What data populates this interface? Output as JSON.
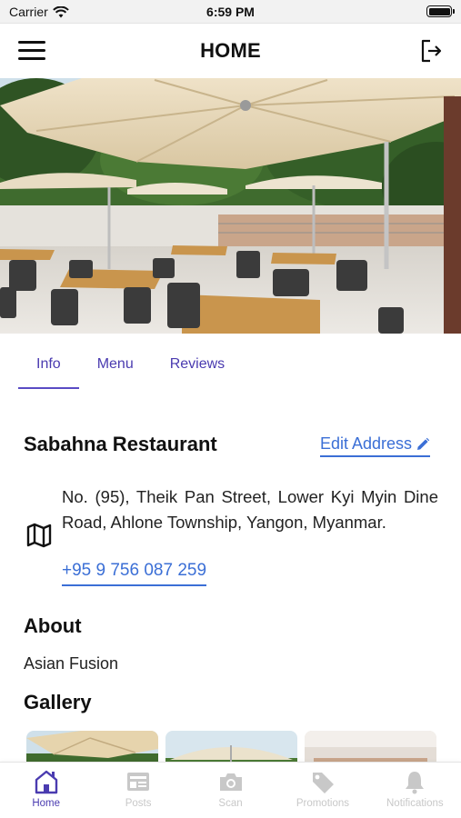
{
  "status_bar": {
    "carrier": "Carrier",
    "time": "6:59 PM"
  },
  "header": {
    "title": "HOME"
  },
  "tabs": [
    {
      "label": "Info",
      "active": true
    },
    {
      "label": "Menu",
      "active": false
    },
    {
      "label": "Reviews",
      "active": false
    }
  ],
  "restaurant": {
    "name": "Sabahna Restaurant",
    "edit_address_label": "Edit Address",
    "address": "No. (95), Theik Pan Street, Lower Kyi Myin Dine Road, Ahlone Township, Yangon, Myanmar.",
    "phone": "+95 9 756 087 259"
  },
  "about": {
    "title": "About",
    "text": "Asian Fusion"
  },
  "gallery": {
    "title": "Gallery"
  },
  "bottom_nav": [
    {
      "label": "Home",
      "icon": "home-icon",
      "active": true
    },
    {
      "label": "Posts",
      "icon": "posts-icon",
      "active": false
    },
    {
      "label": "Scan",
      "icon": "camera-icon",
      "active": false
    },
    {
      "label": "Promotions",
      "icon": "tag-icon",
      "active": false
    },
    {
      "label": "Notifications",
      "icon": "bell-icon",
      "active": false
    }
  ],
  "colors": {
    "accent": "#4a3bb0",
    "link": "#3b6fd6",
    "inactive": "#c8c8c8"
  }
}
